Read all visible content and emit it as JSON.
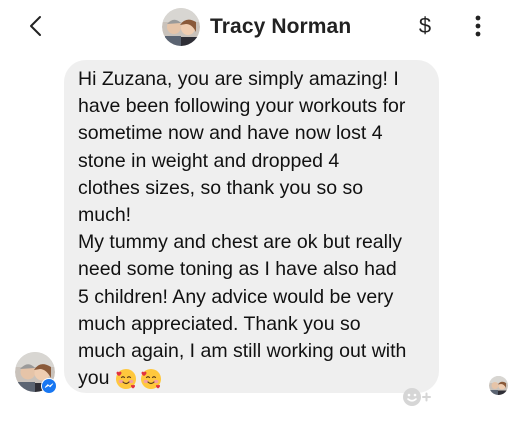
{
  "header": {
    "back_icon": "chevron-left-icon",
    "contact_name": "Tracy Norman",
    "payment_symbol": "$",
    "more_icon": "vertical-ellipsis-icon"
  },
  "message": {
    "lines": [
      "Hi Zuzana, you are simply amazing! I",
      "have been following your workouts for",
      "sometime now and have now lost 4",
      "stone in weight and dropped 4",
      "clothes sizes, so thank you so so",
      "much!",
      "My tummy and chest are ok but really",
      "need some toning as I have also had",
      "5 children! Any advice would be very",
      "much appreciated. Thank you so",
      "much again, I am still working out with",
      "you"
    ],
    "emojis": [
      "smiling-face-with-hearts-emoji",
      "smiling-face-with-hearts-emoji"
    ],
    "bubble_color": "#efefef"
  },
  "sender": {
    "badge_icon": "messenger-icon"
  },
  "reaction": {
    "icon": "add-reaction-icon"
  },
  "colors": {
    "messenger_blue": "#1877f2",
    "text": "#111111"
  }
}
